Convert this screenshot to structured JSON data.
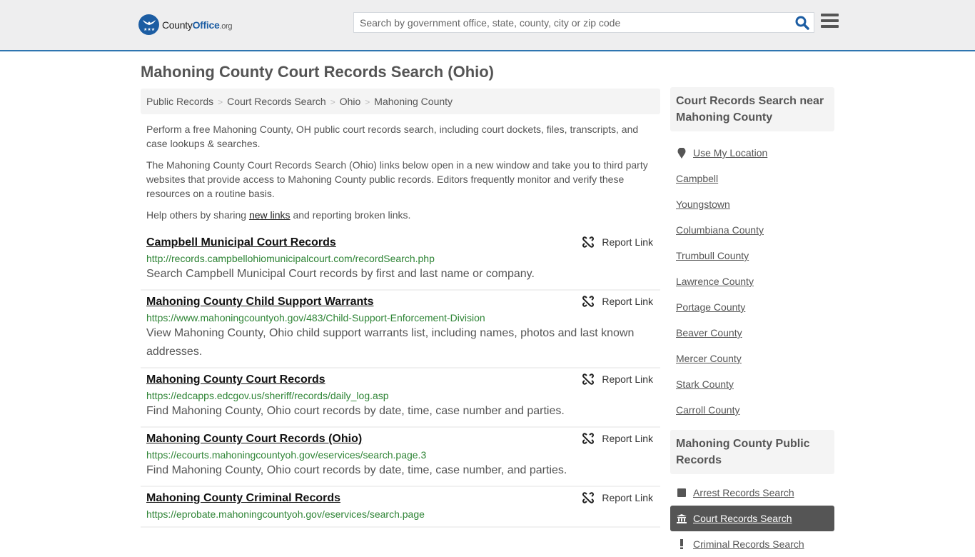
{
  "header": {
    "logo": {
      "brand_a": "County",
      "brand_b": "Office",
      "brand_c": ".org"
    },
    "search": {
      "placeholder": "Search by government office, state, county, city or zip code",
      "value": ""
    },
    "icons": {
      "search": "search-icon",
      "menu": "hamburger-menu-icon"
    }
  },
  "page": {
    "title": "Mahoning County Court Records Search (Ohio)"
  },
  "breadcrumb": [
    {
      "label": "Public Records"
    },
    {
      "label": "Court Records Search"
    },
    {
      "label": "Ohio"
    },
    {
      "label": "Mahoning County"
    }
  ],
  "breadcrumb_separator": ">",
  "intro": {
    "p1": "Perform a free Mahoning County, OH public court records search, including court dockets, files, transcripts, and case lookups & searches.",
    "p2": "The Mahoning County Court Records Search (Ohio) links below open in a new window and take you to third party websites that provide access to Mahoning County public records. Editors frequently monitor and verify these resources on a routine basis.",
    "p3_before": "Help others by sharing ",
    "p3_link": "new links",
    "p3_after": " and reporting broken links."
  },
  "report_label": "Report Link",
  "results": [
    {
      "title": "Campbell Municipal Court Records",
      "url": "http://records.campbellohiomunicipalcourt.com/recordSearch.php",
      "description": "Search Campbell Municipal Court records by first and last name or company."
    },
    {
      "title": "Mahoning County Child Support Warrants",
      "url": "https://www.mahoningcountyoh.gov/483/Child-Support-Enforcement-Division",
      "description": "View Mahoning County, Ohio child support warrants list, including names, photos and last known addresses."
    },
    {
      "title": "Mahoning County Court Records",
      "url": "https://edcapps.edcgov.us/sheriff/records/daily_log.asp",
      "description": "Find Mahoning County, Ohio court records by date, time, case number and parties."
    },
    {
      "title": "Mahoning County Court Records (Ohio)",
      "url": "https://ecourts.mahoningcountyoh.gov/eservices/search.page.3",
      "description": "Find Mahoning County, Ohio court records by date, time, case number, and parties."
    },
    {
      "title": "Mahoning County Criminal Records",
      "url": "https://eprobate.mahoningcountyoh.gov/eservices/search.page",
      "description": ""
    }
  ],
  "sidebar": {
    "nearby_heading": "Court Records Search near Mahoning County",
    "use_location": "Use My Location",
    "nearby": [
      "Campbell",
      "Youngstown",
      "Columbiana County",
      "Trumbull County",
      "Lawrence County",
      "Portage County",
      "Beaver County",
      "Mercer County",
      "Stark County",
      "Carroll County"
    ],
    "public_records_heading": "Mahoning County Public Records",
    "public_records": [
      {
        "label": "Arrest Records Search",
        "icon": "square-icon",
        "active": false
      },
      {
        "label": "Court Records Search",
        "icon": "courthouse-icon",
        "active": true
      },
      {
        "label": "Criminal Records Search",
        "icon": "exclamation-icon",
        "active": false
      }
    ]
  },
  "colors": {
    "accent": "#2e75b0",
    "brand": "#1c5da3",
    "url_green": "#2e8435",
    "active_bg": "#555555"
  }
}
